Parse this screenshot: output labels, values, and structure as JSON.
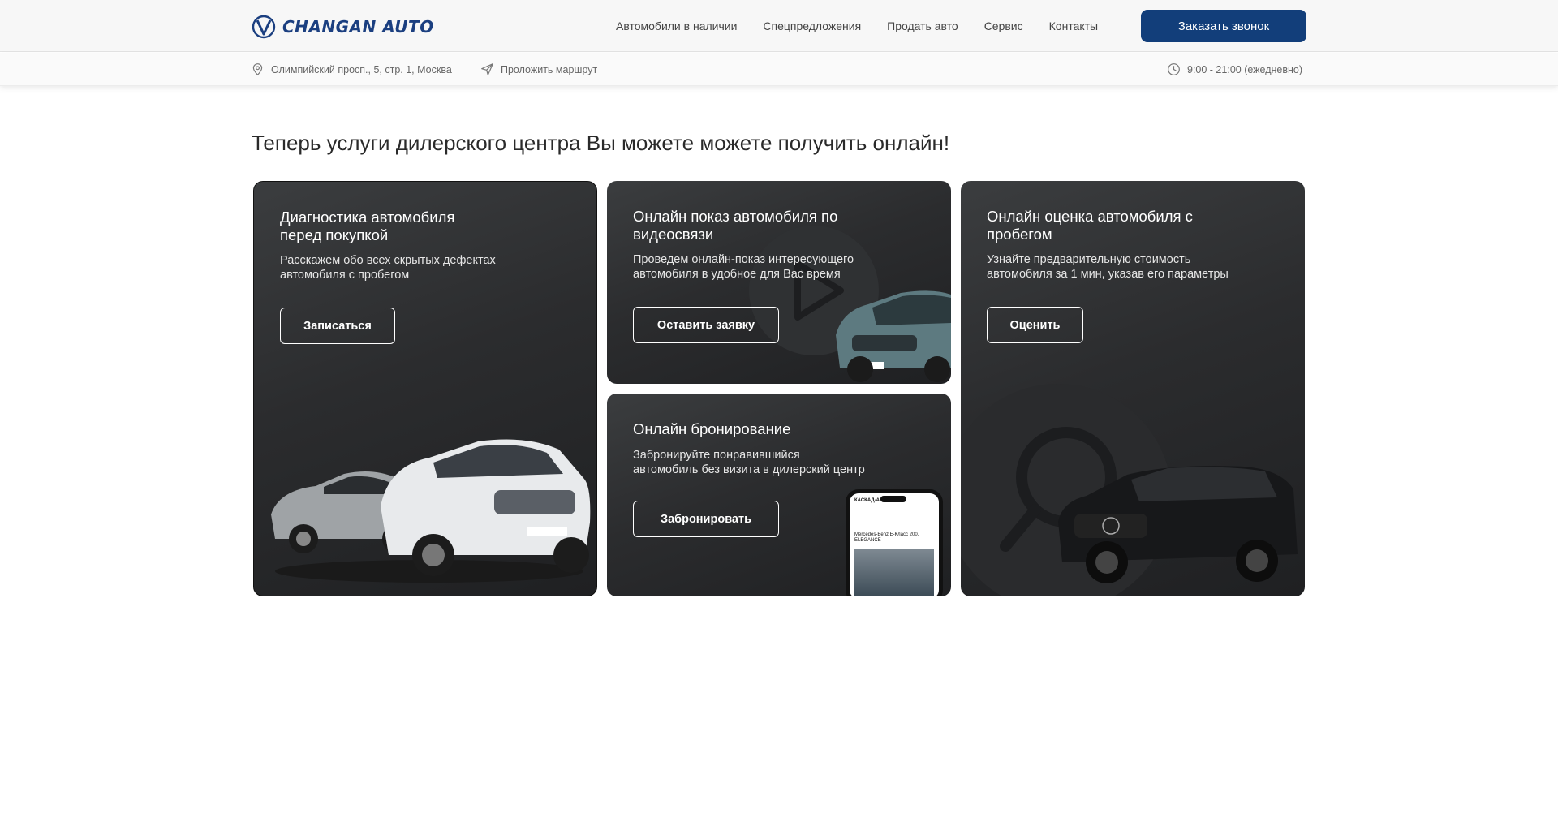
{
  "header": {
    "logo_text": "CHANGAN AUTO",
    "nav": [
      "Автомобили в наличии",
      "Спецпредложения",
      "Продать авто",
      "Сервис",
      "Контакты"
    ],
    "cta_label": "Заказать звонок"
  },
  "subbar": {
    "address": "Олимпийский просп., 5, стр. 1, Москва",
    "route": "Проложить маршрут",
    "hours": "9:00 - 21:00 (ежедневно)"
  },
  "page_title": "Теперь услуги дилерского центра Вы можете можете получить онлайн!",
  "cards": [
    {
      "title_line1": "Диагностика автомобиля",
      "title_line2": "перед покупкой",
      "desc_line1": "Расскажем обо всех скрытых дефектах",
      "desc_line2": "автомобиля с пробегом",
      "button": "Записаться"
    },
    {
      "title_line1": "Онлайн показ автомобиля по",
      "title_line2": "видеосвязи",
      "desc_line1": "Проведем онлайн-показ интересующего",
      "desc_line2": "автомобиля в удобное для Вас время",
      "button": "Оставить заявку"
    },
    {
      "title_line1": "Онлайн бронирование",
      "desc_line1": "Забронируйте понравившийся",
      "desc_line2": "автомобиль без визита в дилерский центр",
      "button": "Забронировать",
      "phone_header": "КАСКАД-АВТО",
      "phone_car": "Mercedes-Benz E-Класс 200, ELEGANCE"
    },
    {
      "title_line1": "Онлайн оценка автомобиля с",
      "title_line2": "пробегом",
      "desc_line1": "Узнайте предварительную стоимость",
      "desc_line2": "автомобиля за 1 мин, указав его параметры",
      "button": "Оценить"
    }
  ],
  "colors": {
    "brand": "#123e7a",
    "card_bg": "#2b2c2e"
  }
}
